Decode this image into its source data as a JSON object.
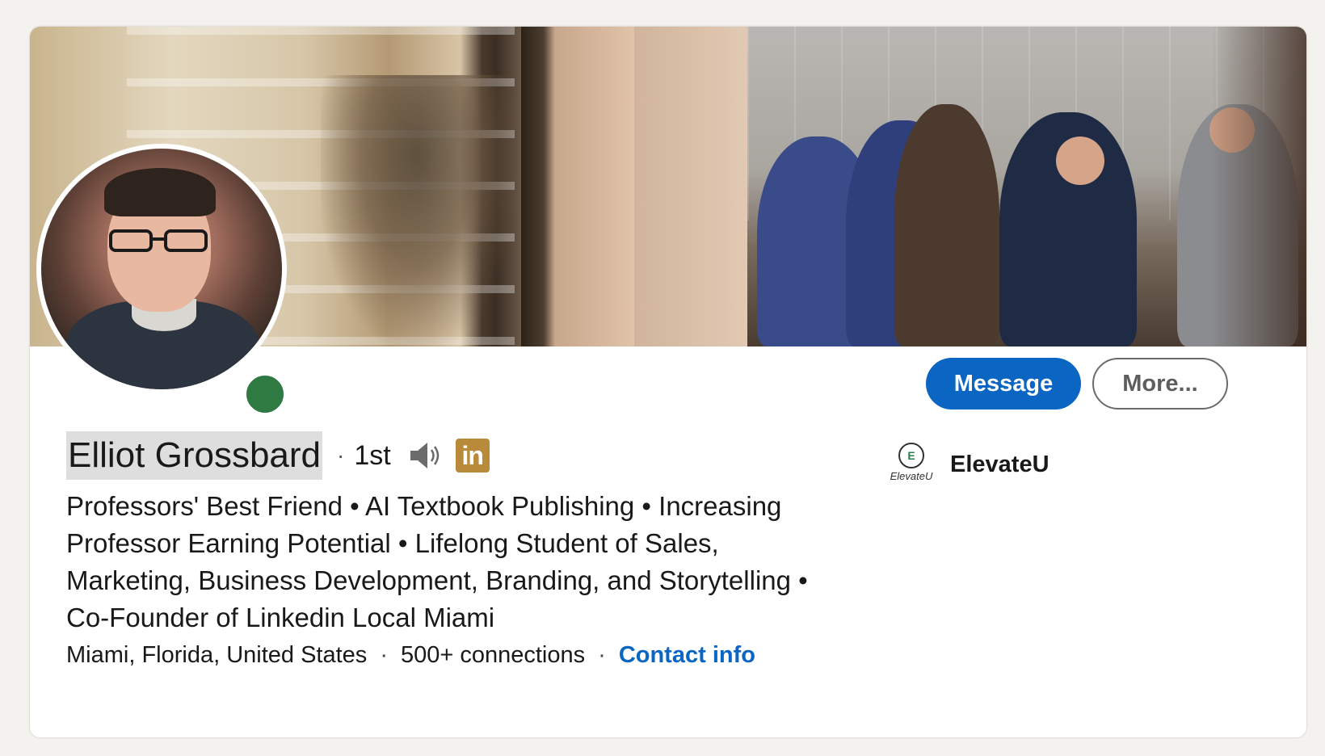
{
  "profile": {
    "name": "Elliot Grossbard",
    "separator": "·",
    "connection_degree": "1st",
    "linkedin_badge": "in",
    "headline": "Professors' Best Friend • AI Textbook Publishing • Increasing Professor Earning Potential • Lifelong Student of Sales, Marketing, Business Development, Branding, and Storytelling • Co-Founder of Linkedin Local Miami",
    "location": "Miami, Florida, United States",
    "connections": "500+ connections",
    "contact_info": "Contact info",
    "online_status": "online"
  },
  "actions": {
    "message_label": "Message",
    "more_label": "More..."
  },
  "company": {
    "name": "ElevateU",
    "logo_mark": "E",
    "logo_wordmark": "ElevateU"
  },
  "colors": {
    "brand_blue": "#0a66c2",
    "online_green": "#2f7a43",
    "linkedin_badge": "#b88a3a",
    "background": "#f4f2ee"
  },
  "icons": {
    "pronunciation": "speaker-icon",
    "linkedin": "linkedin-icon"
  }
}
